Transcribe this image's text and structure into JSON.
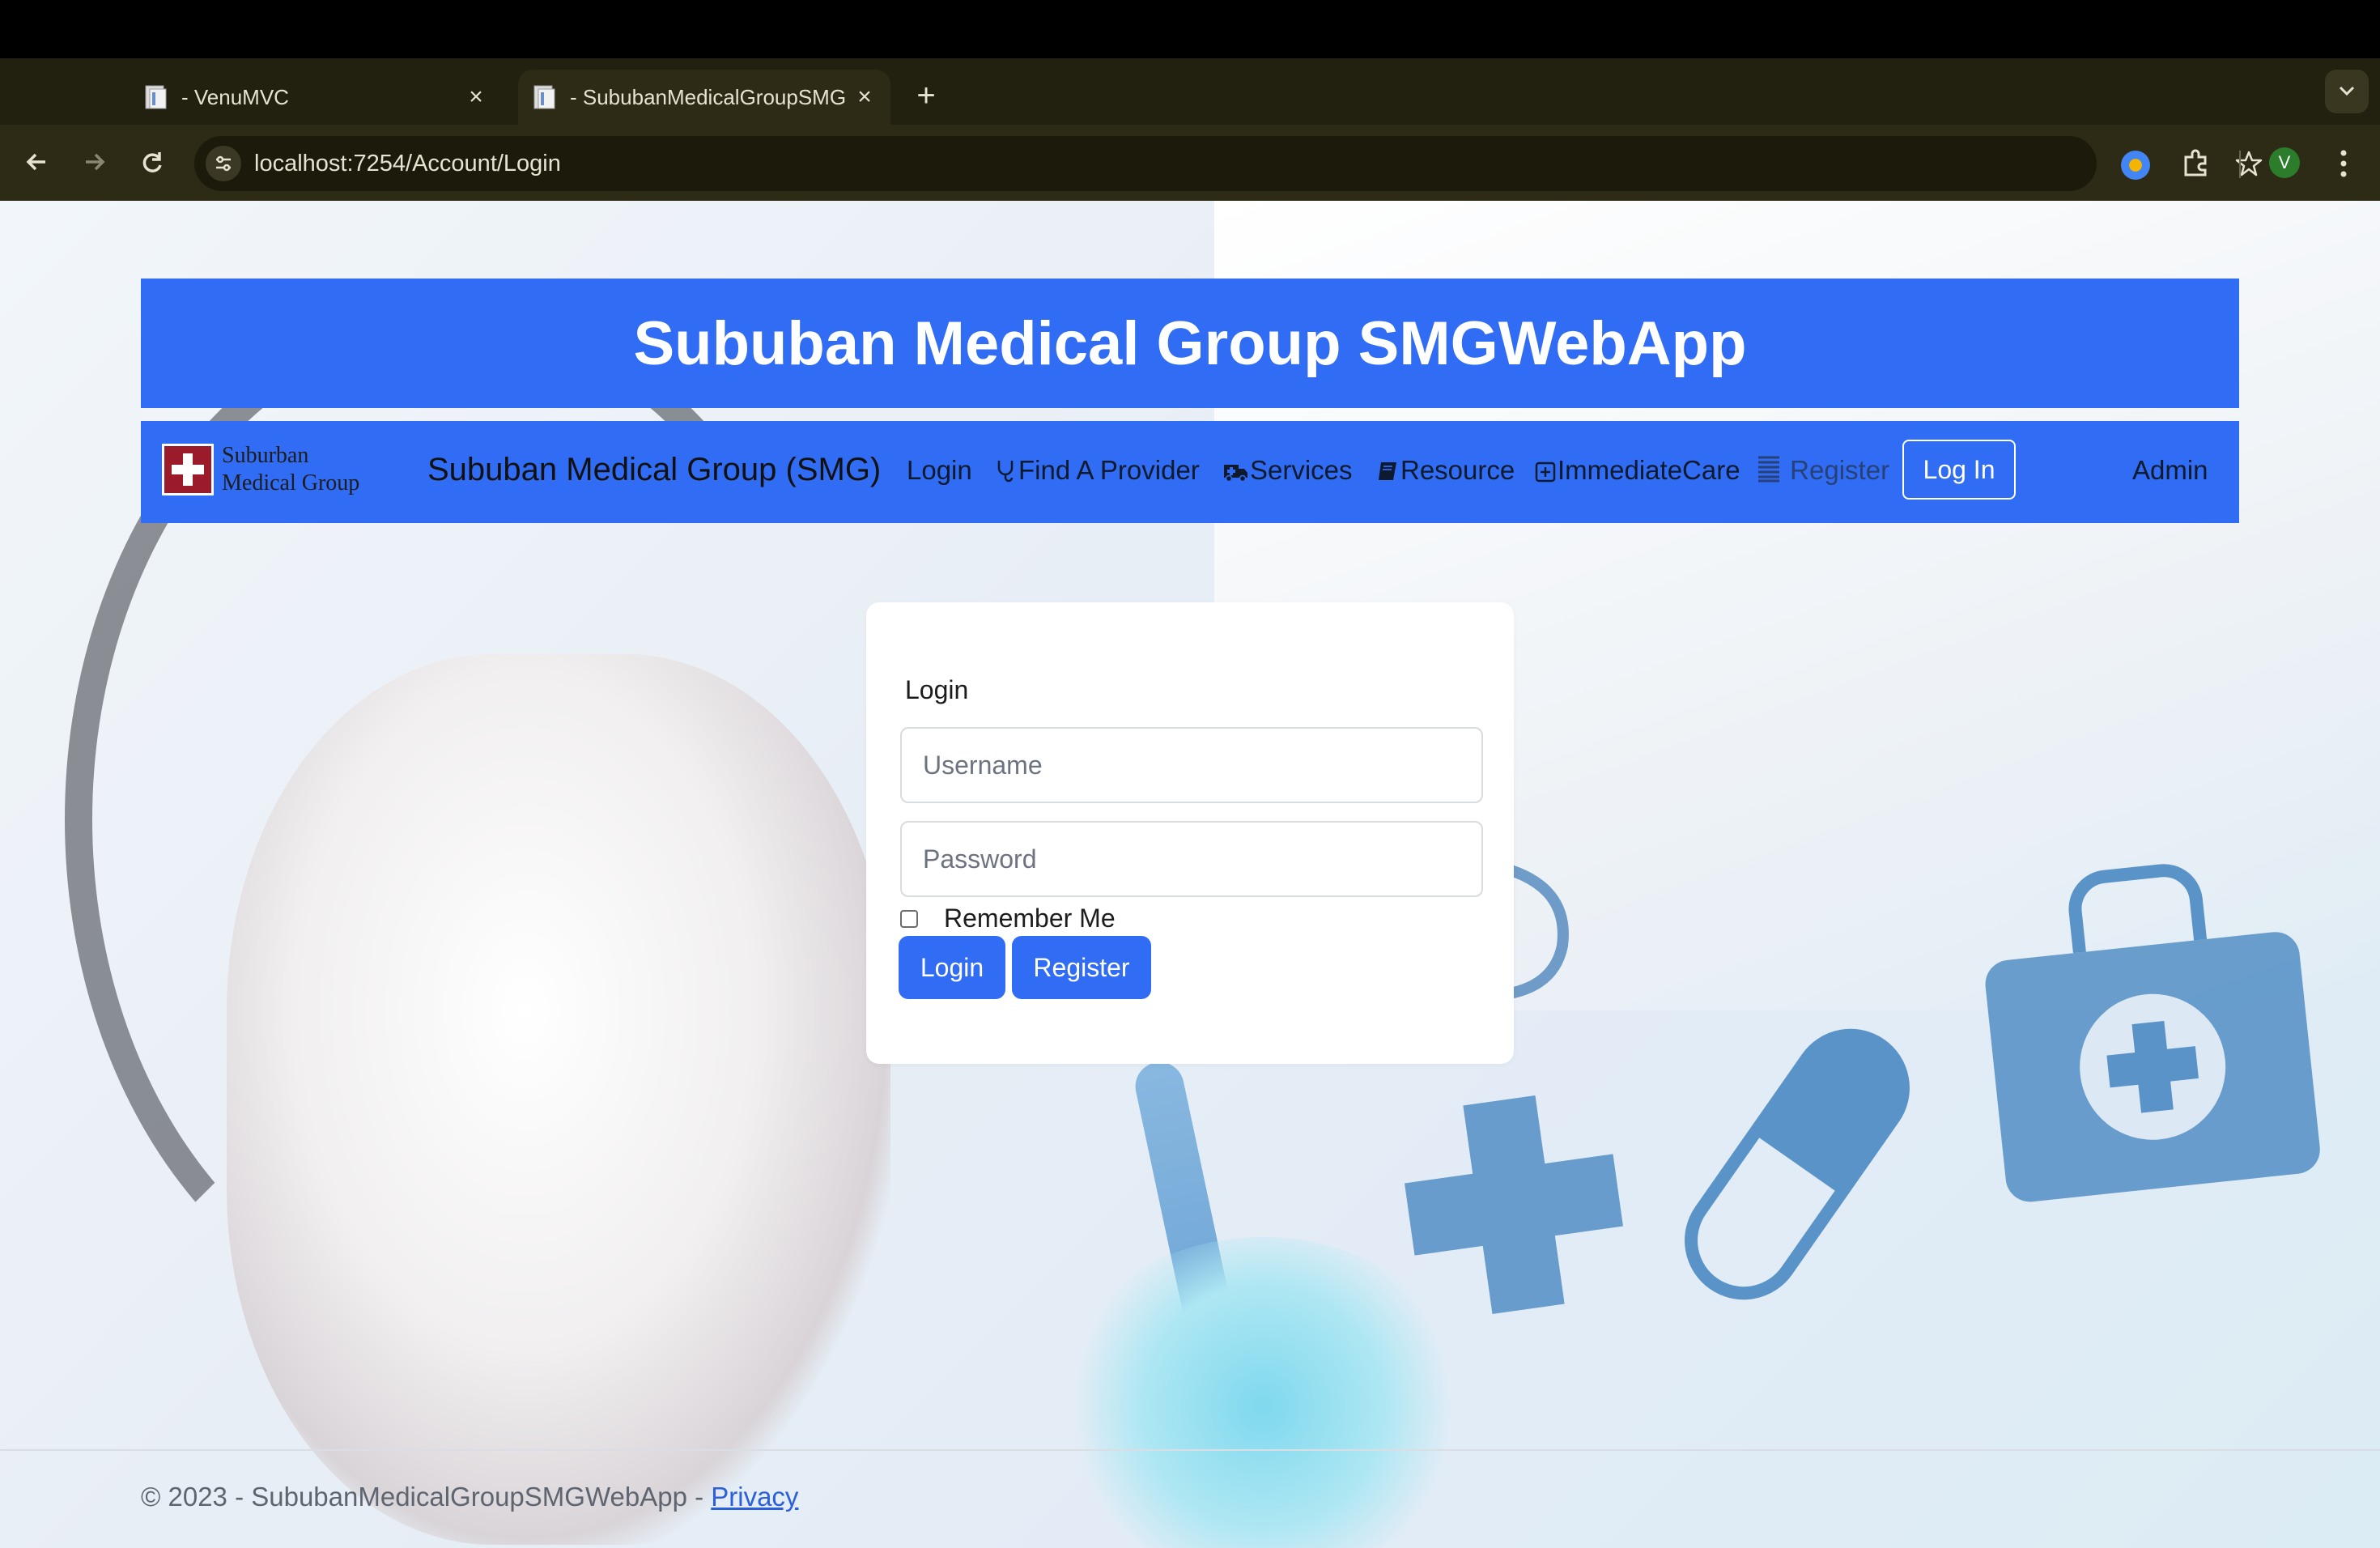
{
  "browser": {
    "tabs": [
      {
        "title": "- VenuMVC",
        "active": false
      },
      {
        "title": "- SububanMedicalGroupSMG",
        "active": true
      }
    ],
    "url": "localhost:7254/Account/Login",
    "profile_initial": "V"
  },
  "hero": {
    "title": "Sububan Medical Group SMGWebApp"
  },
  "navbar": {
    "logo_line1": "Suburban",
    "logo_line2": "Medical Group",
    "brand": "Sububan Medical Group (SMG)",
    "links": {
      "login": "Login",
      "find_provider": "Find A Provider",
      "services": "Services",
      "resource": "Resource",
      "immediate_care": "ImmediateCare",
      "register": "Register",
      "log_in_button": "Log In",
      "admin": "Admin"
    }
  },
  "login_card": {
    "title": "Login",
    "username_placeholder": "Username",
    "password_placeholder": "Password",
    "remember_label": "Remember Me",
    "login_button": "Login",
    "register_button": "Register"
  },
  "footer": {
    "text": "© 2023 - SububanMedicalGroupSMGWebApp - ",
    "privacy_link": "Privacy"
  },
  "colors": {
    "primary": "#316cf4",
    "chrome": "#2d2a16",
    "logo_red": "#9b1b2a"
  }
}
